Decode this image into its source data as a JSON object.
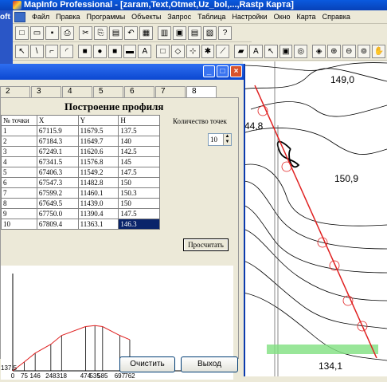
{
  "app": {
    "title": "MapInfo Professional - [zaram,Text,Otmet,Uz_bol,...,Rastp Карта]",
    "left_fragment": "oft"
  },
  "menu": [
    "Файл",
    "Правка",
    "Программы",
    "Объекты",
    "Запрос",
    "Таблица",
    "Настройки",
    "Окно",
    "Карта",
    "Справка"
  ],
  "toolbar1_icons": [
    "new-doc-icon",
    "open-icon",
    "save-icon",
    "print-icon",
    "cut-icon",
    "copy-icon",
    "paste-icon",
    "undo-icon",
    "table-icon",
    "browser-icon",
    "map-icon",
    "graph-icon",
    "layout-icon",
    "help-icon"
  ],
  "toolbar2_icons": [
    "select-icon",
    "line-icon",
    "polyline-icon",
    "arc-icon",
    "polygon-icon",
    "ellipse-icon",
    "rectangle-icon",
    "rounded-rect-icon",
    "text-icon",
    "frame-icon",
    "reshape-icon",
    "add-node-icon",
    "symbol-style-icon",
    "line-style-icon",
    "region-style-icon",
    "text-style-icon",
    "pointer-icon",
    "marquee-icon",
    "radius-icon",
    "boundary-icon",
    "zoom-in-icon",
    "zoom-out-icon",
    "change-view-icon",
    "grabber-icon"
  ],
  "toolbar2_glyphs": [
    "↖",
    "\\",
    "⌐",
    "◜",
    "■",
    "●",
    "■",
    "▬",
    "A",
    "□",
    "◇",
    "⊹",
    "✱",
    "⟋",
    "▰",
    "A",
    "↖",
    "▣",
    "◎",
    "◈",
    "⊕",
    "⊖",
    "⊚",
    "✋"
  ],
  "toolbar1_glyphs": [
    "□",
    "▭",
    "▪",
    "⎙",
    "✂",
    "⎘",
    "▤",
    "↶",
    "▦",
    "▥",
    "▣",
    "▤",
    "▧",
    "?"
  ],
  "map": {
    "labels": {
      "top": "149,0",
      "left": "44,8",
      "mid": "150,9",
      "bottom": "134,1"
    },
    "profile_line_color": "#e02020",
    "contour_color": "#000000",
    "green_color": "#80e080"
  },
  "dialog": {
    "tabs": [
      "2",
      "3",
      "4",
      "5",
      "6",
      "7",
      "8"
    ],
    "active_tab": "8",
    "panel_title": "Построение профиля",
    "table": {
      "headers": [
        "№ точки",
        "X",
        "Y",
        "H"
      ],
      "rows": [
        [
          "1",
          "67115.9",
          "11679.5",
          "137.5"
        ],
        [
          "2",
          "67184.3",
          "11649.7",
          "140"
        ],
        [
          "3",
          "67249.1",
          "11620.6",
          "142.5"
        ],
        [
          "4",
          "67341.5",
          "11576.8",
          "145"
        ],
        [
          "5",
          "67406.3",
          "11549.2",
          "147.5"
        ],
        [
          "6",
          "67547.3",
          "11482.8",
          "150"
        ],
        [
          "7",
          "67599.2",
          "11460.1",
          "150.3"
        ],
        [
          "8",
          "67649.5",
          "11439.0",
          "150"
        ],
        [
          "9",
          "67750.0",
          "11390.4",
          "147.5"
        ],
        [
          "10",
          "67809.4",
          "11363.1",
          "146.3"
        ]
      ]
    },
    "npoints_label": "Количество точек",
    "npoints_value": "10",
    "calc_label": "Просчитать",
    "clear_label": "Очистить",
    "exit_label": "Выход"
  },
  "chart_data": {
    "type": "line",
    "title": "",
    "xlabel": "",
    "ylabel": "",
    "x_tick_labels": [
      "0",
      "75",
      "146",
      "248",
      "318",
      "474",
      "535",
      "585",
      "697",
      "762"
    ],
    "y_tick_labels": [
      "137,5"
    ],
    "x": [
      0,
      75,
      146,
      248,
      318,
      474,
      535,
      585,
      697,
      762
    ],
    "series": [
      {
        "values": [
          137.5,
          140,
          142.5,
          145,
          147.5,
          150,
          150.3,
          150,
          147.5,
          146.3
        ]
      }
    ],
    "ylim": [
      137.5,
      165
    ],
    "xlim": [
      0,
      1400
    ],
    "line_color": "#e02020",
    "bar_color": "#000000"
  }
}
